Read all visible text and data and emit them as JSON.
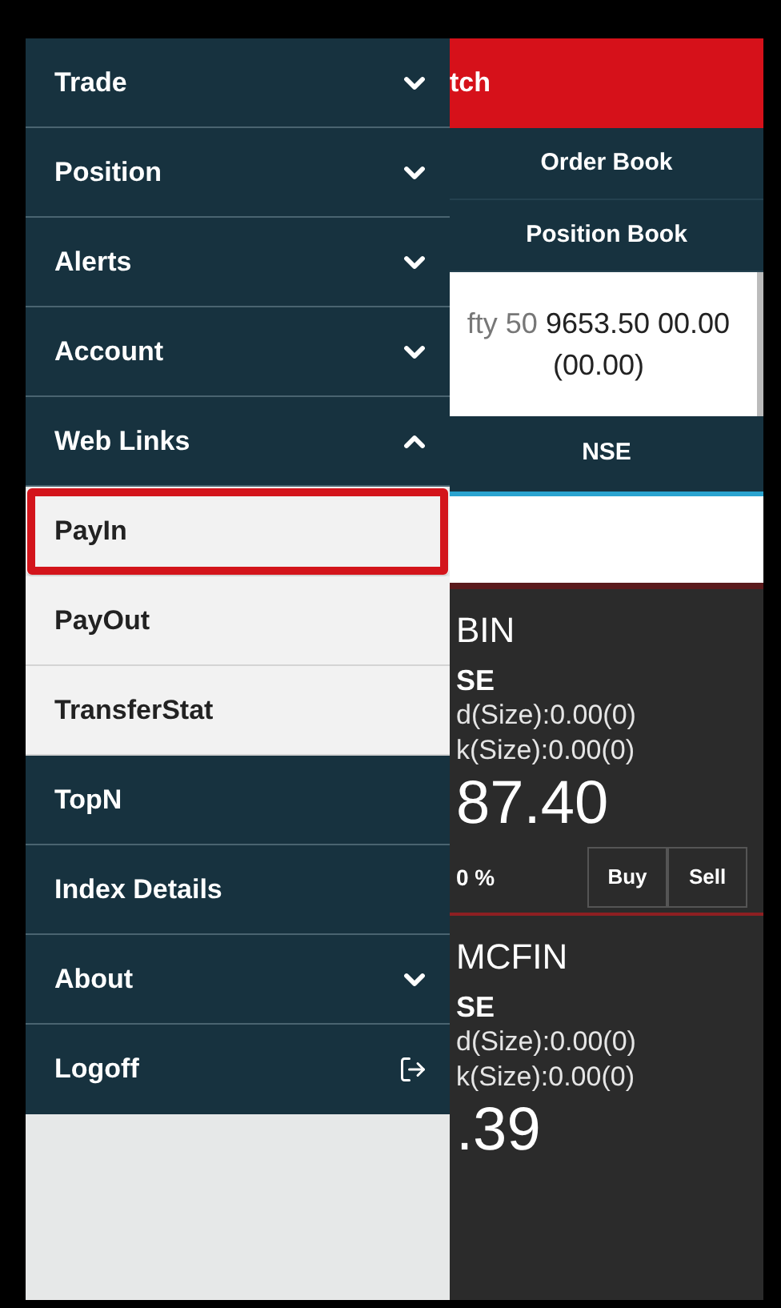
{
  "menu": [
    {
      "label": "Trade",
      "kind": "group",
      "expanded": false
    },
    {
      "label": "Position",
      "kind": "group",
      "expanded": false
    },
    {
      "label": "Alerts",
      "kind": "group",
      "expanded": false
    },
    {
      "label": "Account",
      "kind": "group",
      "expanded": false
    },
    {
      "label": "Web Links",
      "kind": "group",
      "expanded": true,
      "children": [
        {
          "label": "PayIn",
          "selected": true
        },
        {
          "label": "PayOut",
          "selected": false
        },
        {
          "label": "TransferStat",
          "selected": false
        }
      ]
    },
    {
      "label": "TopN",
      "kind": "link"
    },
    {
      "label": "Index Details",
      "kind": "link"
    },
    {
      "label": "About",
      "kind": "group",
      "expanded": false
    },
    {
      "label": "Logoff",
      "kind": "action"
    }
  ],
  "header": {
    "title": "tch"
  },
  "nav_buttons": [
    "Order Book",
    "Position Book"
  ],
  "index_ticker": {
    "name": "fty 50",
    "value": "9653.50 00.00",
    "change": "(00.00)"
  },
  "exchange_tab": "NSE",
  "stocks": [
    {
      "symbol": "BIN",
      "exchange": "SE",
      "bid": "d(Size):0.00(0)",
      "ask": "k(Size):0.00(0)",
      "price": "87.40",
      "change": "0 %",
      "buy": "Buy",
      "sell": "Sell"
    },
    {
      "symbol": "MCFIN",
      "exchange": "SE",
      "bid": "d(Size):0.00(0)",
      "ask": "k(Size):0.00(0)",
      "price": ".39"
    }
  ]
}
